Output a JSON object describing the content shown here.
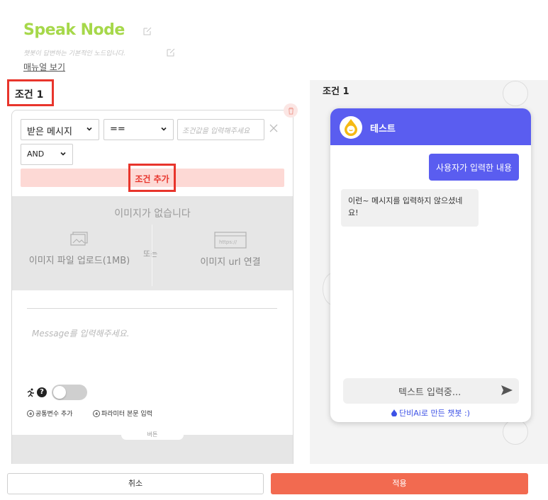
{
  "node": {
    "title": "Speak Node",
    "description": "챗봇이 답변하는 기본적인 노드입니다.",
    "manual_link": "매뉴얼 보기"
  },
  "condition": {
    "label": "조건 1",
    "field_select": "받은 메시지",
    "operator_select": "==",
    "value_placeholder": "조건값을 입력해주세요",
    "logic_select": "AND",
    "add_condition_label": "조건 추가"
  },
  "image": {
    "empty_text": "이미지가 없습니다",
    "upload_label": "이미지 파일 업로드(1MB)",
    "or_text": "또는",
    "url_label": "이미지 url 연결",
    "url_icon_text": "https://"
  },
  "message": {
    "placeholder": "Message를 입력해주세요."
  },
  "options": {
    "help": "?",
    "add_common_var": "공통변수 추가",
    "param_body_input": "파라미터 본문 입력",
    "button_tab": "버튼"
  },
  "preview": {
    "condition_label": "조건 1",
    "chat_title": "테스트",
    "user_message": "사용자가 입력한 내용",
    "bot_message": "이런~ 메시지를 입력하지 않으셨네요!",
    "input_placeholder": "텍스트 입력중...",
    "credit": "단비Ai로 만든 챗봇 :)"
  },
  "footer": {
    "cancel_label": "취소",
    "apply_label": "적용"
  },
  "colors": {
    "title_green": "#a6d84a",
    "highlight_red": "#e8352c",
    "chat_accent": "#5a5df0",
    "apply_orange": "#f26a50"
  },
  "icons": [
    "edit-icon",
    "trash-icon",
    "chevron-down-icon",
    "close-icon",
    "image-upload-icon",
    "url-icon",
    "runner-icon",
    "help-icon",
    "plus-circle-icon",
    "chatbot-avatar-icon",
    "send-icon",
    "drop-icon"
  ]
}
